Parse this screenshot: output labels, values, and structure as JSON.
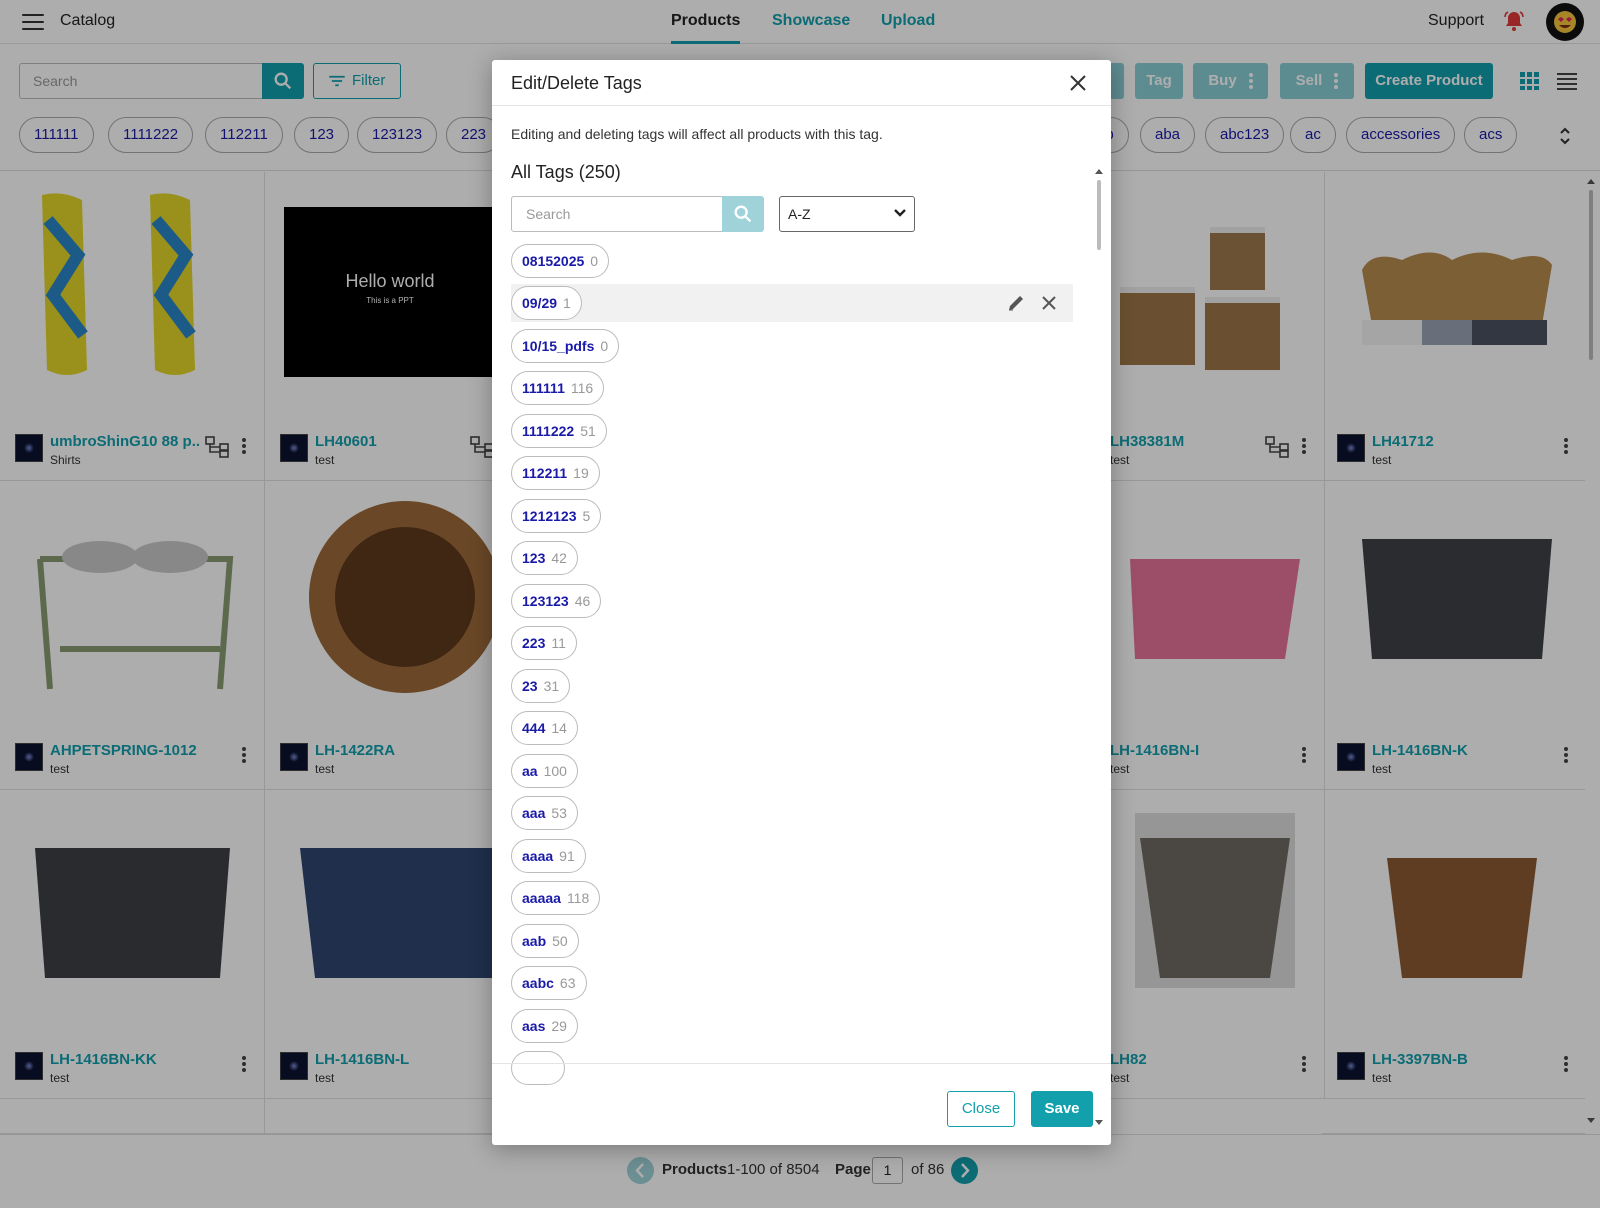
{
  "app": {
    "title": "Catalog"
  },
  "nav": {
    "tabs": [
      "Products",
      "Showcase",
      "Upload"
    ],
    "support": "Support"
  },
  "toolbar": {
    "search_placeholder": "Search",
    "filter_label": "Filter",
    "tag_label": "Tag",
    "buy_label": "Buy",
    "sell_label": "Sell",
    "create_label": "Create Product"
  },
  "chips": [
    "111111",
    "1111222",
    "112211",
    "123",
    "123123",
    "223",
    "ab",
    "aba",
    "abc123",
    "ac",
    "accessories",
    "acs"
  ],
  "products": [
    {
      "sku": "umbroShinG10 88 p...",
      "cat": "Shirts"
    },
    {
      "sku": "LH40601",
      "cat": "test",
      "img_title": "Hello world",
      "img_sub": "This is a PPT"
    },
    {
      "sku": "LH38381M",
      "cat": "test"
    },
    {
      "sku": "LH41712",
      "cat": "test"
    },
    {
      "sku": "AHPETSPRING-1012",
      "cat": "test"
    },
    {
      "sku": "LH-1422RA",
      "cat": "test"
    },
    {
      "sku": "LH-1416BN-I",
      "cat": "test"
    },
    {
      "sku": "LH-1416BN-K",
      "cat": "test"
    },
    {
      "sku": "LH-1416BN-KK",
      "cat": "test"
    },
    {
      "sku": "LH-1416BN-L",
      "cat": "test"
    },
    {
      "sku": "LH82",
      "cat": "test"
    },
    {
      "sku": "LH-3397BN-B",
      "cat": "test"
    }
  ],
  "pagination": {
    "products_label": "Products",
    "range": "1-100 of 8504",
    "page_label": "Page",
    "page": "1",
    "of_pages": "of 86"
  },
  "modal": {
    "title": "Edit/Delete Tags",
    "note": "Editing and deleting tags will affect all products with this tag.",
    "all_tags": "All Tags (250)",
    "search_placeholder": "Search",
    "sort": "A-Z",
    "close_label": "Close",
    "save_label": "Save",
    "tags": [
      {
        "name": "08152025",
        "count": "0"
      },
      {
        "name": "09/29",
        "count": "1"
      },
      {
        "name": "10/15_pdfs",
        "count": "0"
      },
      {
        "name": "111111",
        "count": "116"
      },
      {
        "name": "1111222",
        "count": "51"
      },
      {
        "name": "112211",
        "count": "19"
      },
      {
        "name": "1212123",
        "count": "5"
      },
      {
        "name": "123",
        "count": "42"
      },
      {
        "name": "123123",
        "count": "46"
      },
      {
        "name": "223",
        "count": "11"
      },
      {
        "name": "23",
        "count": "31"
      },
      {
        "name": "444",
        "count": "14"
      },
      {
        "name": "aa",
        "count": "100"
      },
      {
        "name": "aaa",
        "count": "53"
      },
      {
        "name": "aaaa",
        "count": "91"
      },
      {
        "name": "aaaaa",
        "count": "118"
      },
      {
        "name": "aab",
        "count": "50"
      },
      {
        "name": "aabc",
        "count": "63"
      },
      {
        "name": "aas",
        "count": "29"
      }
    ]
  },
  "colors": {
    "accent": "#13a0ad",
    "tag_text": "#1a1aa8",
    "bell": "#e03a3a"
  }
}
